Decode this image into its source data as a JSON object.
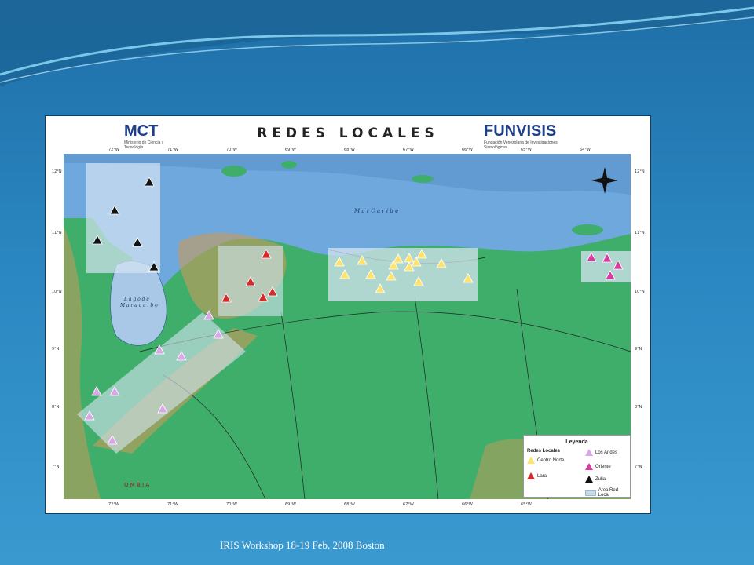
{
  "slide": {
    "footer": "IRIS Workshop 18-19 Feb, 2008   Boston",
    "background_color": "#2a86c0"
  },
  "map": {
    "title": "REDES LOCALES",
    "left_logo": {
      "mark": "MCT",
      "subtitle": "Ministerio de Ciencia y Tecnología"
    },
    "right_logo": {
      "mark": "FUNVISIS",
      "subtitle": "Fundación Venezolana de Investigaciones Sismológicas"
    },
    "sea_label": "M a r   C a r i b e",
    "lake_label_1": "L a g o   d e",
    "lake_label_2": "M a r a c a i b o",
    "neighbor_label": "O M B I A",
    "longitude_ticks": [
      "72°W",
      "71°W",
      "70°W",
      "69°W",
      "68°W",
      "67°W",
      "66°W",
      "65°W",
      "64°W"
    ],
    "latitude_ticks": [
      "12°N",
      "11°N",
      "10°N",
      "9°N",
      "8°N",
      "7°N"
    ],
    "colors": {
      "sea": "#6fa8dc",
      "land": "#3fae6b",
      "highlands": "#c99a5a",
      "network_area": "#d6e4f2",
      "centro_norte": "#ffe36b",
      "lara": "#d42a2a",
      "los_andes": "#d9a6e8",
      "oriente": "#d63ba0",
      "zulia": "#111111"
    }
  },
  "legend": {
    "title": "Leyenda",
    "subtitle": "Redes Locales",
    "items": [
      {
        "label": "Centro Norte",
        "color": "#ffe36b"
      },
      {
        "label": "Lara",
        "color": "#d42a2a"
      },
      {
        "label": "Los Andes",
        "color": "#d9a6e8"
      },
      {
        "label": "Oriente",
        "color": "#d63ba0"
      },
      {
        "label": "Zulia",
        "color": "#111111"
      },
      {
        "label": "Área Red Local",
        "color": "#c9dcef"
      }
    ]
  }
}
